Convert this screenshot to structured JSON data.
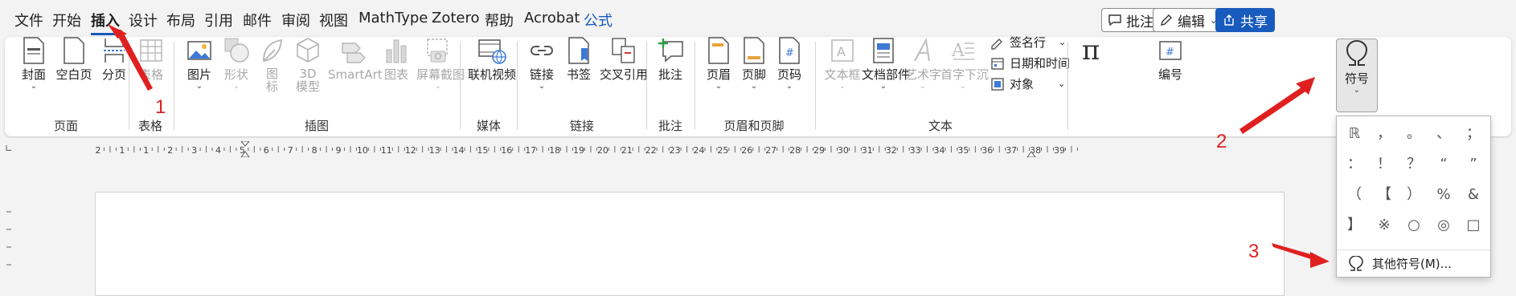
{
  "menu": {
    "items": [
      "文件",
      "开始",
      "插入",
      "设计",
      "布局",
      "引用",
      "邮件",
      "审阅",
      "视图",
      "MathType",
      "Zotero",
      "帮助",
      "Acrobat",
      "公式"
    ],
    "active": "插入"
  },
  "top_buttons": {
    "comment": "批注",
    "edit": "编辑",
    "share": "共享"
  },
  "ribbon": {
    "pages": {
      "cover": "封面",
      "blank": "空白页",
      "break": "分页",
      "group": "页面"
    },
    "table": {
      "table": "表格",
      "group": "表格"
    },
    "illustrations": {
      "picture": "图片",
      "shapes": "形状",
      "icons": "图标",
      "model3d": "3D 模型",
      "smartart": "SmartArt",
      "chart": "图表",
      "screenshot": "屏幕截图",
      "group": "插图"
    },
    "media": {
      "video": "联机视频",
      "group": "媒体"
    },
    "links": {
      "link": "链接",
      "bookmark": "书签",
      "crossref": "交叉引用",
      "group": "链接"
    },
    "comments": {
      "comment": "批注",
      "group": "批注"
    },
    "headerfooter": {
      "header": "页眉",
      "footer": "页脚",
      "pagenum": "页码",
      "group": "页眉和页脚"
    },
    "text": {
      "textbox": "文本框",
      "quickparts": "文档部件",
      "wordart": "艺术字",
      "dropcap": "首字下沉",
      "signature": "签名行",
      "datetime": "日期和时间",
      "object": "对象",
      "group": "文本"
    },
    "symbols": {
      "equation_glyph": "π",
      "symbol": "符号",
      "number": "编号"
    }
  },
  "ruler": {
    "numbers": [
      "2",
      "1",
      "1",
      "2",
      "3",
      "4",
      "5",
      "6",
      "7",
      "8",
      "9",
      "10",
      "11",
      "12",
      "13",
      "14",
      "15",
      "16",
      "17",
      "18",
      "19",
      "20",
      "21",
      "22",
      "23",
      "24",
      "25",
      "26",
      "27",
      "28",
      "29",
      "30",
      "31",
      "32",
      "33",
      "34",
      "35",
      "36",
      "37",
      "38",
      "39"
    ]
  },
  "symbol_dropdown": {
    "symbols": [
      "ℝ",
      "，",
      "。",
      "、",
      "；",
      "：",
      "！",
      "？",
      "“",
      "”",
      "（",
      "【",
      "）",
      "%",
      "&",
      "】",
      "※",
      "○",
      "◎",
      "□"
    ],
    "more_label": "其他符号(M)..."
  },
  "annotations": [
    "1",
    "2",
    "3"
  ],
  "colors": {
    "accent": "#185abd",
    "annotation": "#e02020"
  }
}
